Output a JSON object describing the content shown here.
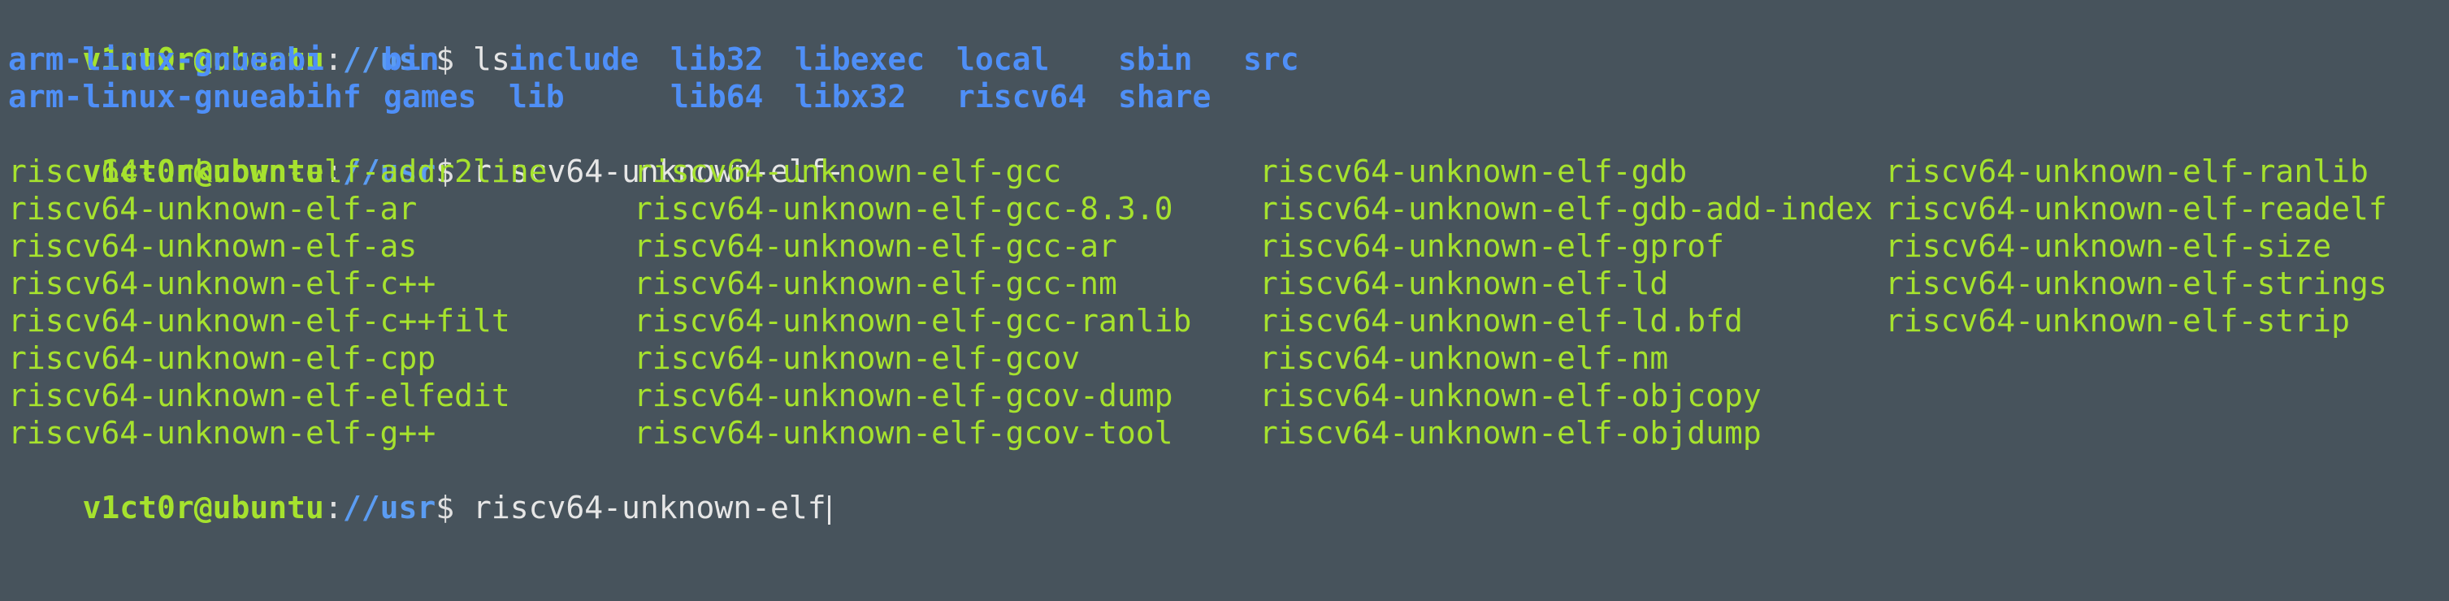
{
  "prompt": {
    "user": "v1ct0r@ubuntu",
    "colon": ":",
    "path": "//usr",
    "dollar": "$ "
  },
  "commands": {
    "first": "ls",
    "second": "riscv64-unknown-elf-",
    "third": "riscv64-unknown-elf"
  },
  "ls_rows": [
    [
      "arm-linux-gnueabi",
      "bin",
      "include",
      "lib32",
      "libexec",
      "local",
      "sbin",
      "src"
    ],
    [
      "arm-linux-gnueabihf",
      "games",
      "lib",
      "lib64",
      "libx32",
      "riscv64",
      "share",
      ""
    ]
  ],
  "completion_rows": [
    [
      "riscv64-unknown-elf-addr2line",
      "riscv64-unknown-elf-gcc",
      "riscv64-unknown-elf-gdb",
      "riscv64-unknown-elf-ranlib"
    ],
    [
      "riscv64-unknown-elf-ar",
      "riscv64-unknown-elf-gcc-8.3.0",
      "riscv64-unknown-elf-gdb-add-index",
      "riscv64-unknown-elf-readelf"
    ],
    [
      "riscv64-unknown-elf-as",
      "riscv64-unknown-elf-gcc-ar",
      "riscv64-unknown-elf-gprof",
      "riscv64-unknown-elf-size"
    ],
    [
      "riscv64-unknown-elf-c++",
      "riscv64-unknown-elf-gcc-nm",
      "riscv64-unknown-elf-ld",
      "riscv64-unknown-elf-strings"
    ],
    [
      "riscv64-unknown-elf-c++filt",
      "riscv64-unknown-elf-gcc-ranlib",
      "riscv64-unknown-elf-ld.bfd",
      "riscv64-unknown-elf-strip"
    ],
    [
      "riscv64-unknown-elf-cpp",
      "riscv64-unknown-elf-gcov",
      "riscv64-unknown-elf-nm",
      ""
    ],
    [
      "riscv64-unknown-elf-elfedit",
      "riscv64-unknown-elf-gcov-dump",
      "riscv64-unknown-elf-objcopy",
      ""
    ],
    [
      "riscv64-unknown-elf-g++",
      "riscv64-unknown-elf-gcov-tool",
      "riscv64-unknown-elf-objdump",
      ""
    ]
  ],
  "colors": {
    "background": "#47535c",
    "prompt_user": "#a6e22e",
    "prompt_path": "#5b9cf2",
    "directory": "#4f8ff7",
    "executable": "#a6e22e"
  }
}
